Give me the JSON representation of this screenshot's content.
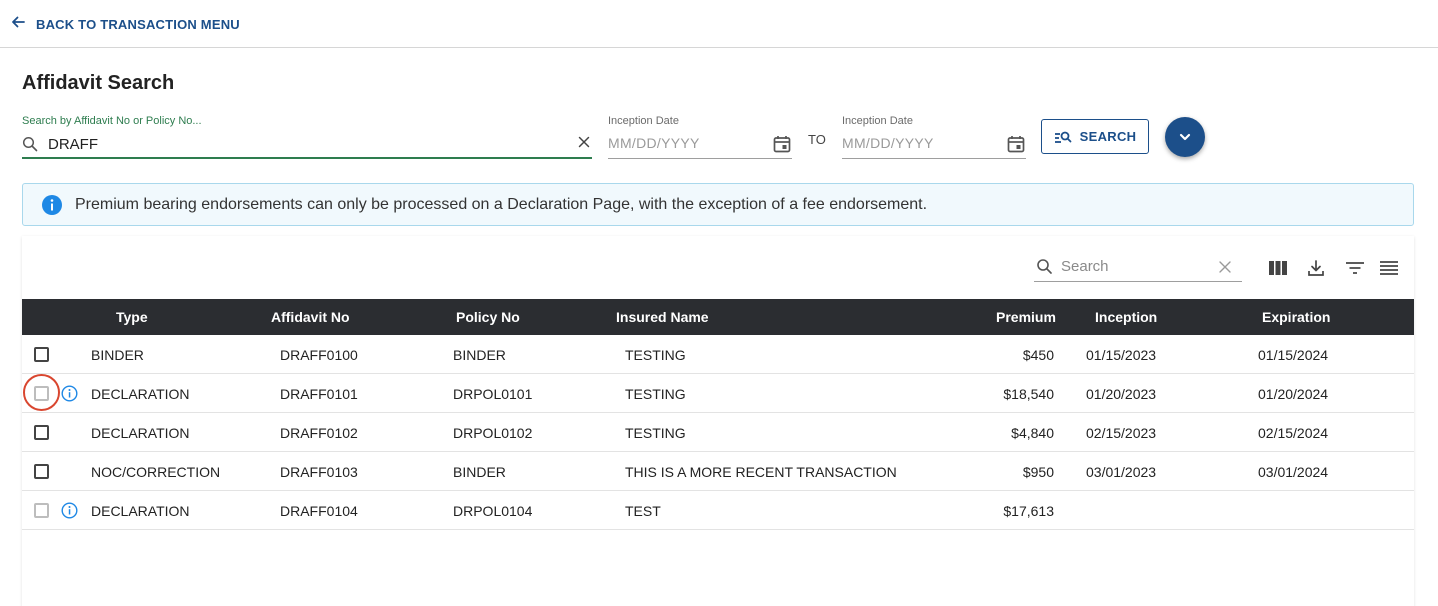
{
  "nav": {
    "back_label": "BACK TO TRANSACTION MENU"
  },
  "page": {
    "title": "Affidavit Search"
  },
  "filters": {
    "search_label": "Search by Affidavit No or Policy No...",
    "search_value": "DRAFF",
    "inception_from_label": "Inception Date",
    "inception_from_placeholder": "MM/DD/YYYY",
    "to_label": "TO",
    "inception_to_label": "Inception Date",
    "inception_to_placeholder": "MM/DD/YYYY",
    "search_button": "SEARCH"
  },
  "banner": {
    "message": "Premium bearing endorsements can only be processed on a Declaration Page, with the exception of a fee endorsement."
  },
  "table": {
    "search_placeholder": "Search",
    "columns": [
      "Type",
      "Affidavit No",
      "Policy No",
      "Insured Name",
      "Premium",
      "Inception",
      "Expiration"
    ],
    "rows": [
      {
        "type": "BINDER",
        "affidavit_no": "DRAFF0100",
        "policy_no": "BINDER",
        "insured_name": "TESTING",
        "premium": "$450",
        "inception": "01/15/2023",
        "expiration": "01/15/2024",
        "selectable": true,
        "info": false
      },
      {
        "type": "DECLARATION",
        "affidavit_no": "DRAFF0101",
        "policy_no": "DRPOL0101",
        "insured_name": "TESTING",
        "premium": "$18,540",
        "inception": "01/20/2023",
        "expiration": "01/20/2024",
        "selectable": false,
        "info": true
      },
      {
        "type": "DECLARATION",
        "affidavit_no": "DRAFF0102",
        "policy_no": "DRPOL0102",
        "insured_name": "TESTING",
        "premium": "$4,840",
        "inception": "02/15/2023",
        "expiration": "02/15/2024",
        "selectable": true,
        "info": false
      },
      {
        "type": "NOC/CORRECTION",
        "affidavit_no": "DRAFF0103",
        "policy_no": "BINDER",
        "insured_name": "THIS IS A MORE RECENT TRANSACTION",
        "premium": "$950",
        "inception": "03/01/2023",
        "expiration": "03/01/2024",
        "selectable": true,
        "info": false
      },
      {
        "type": "DECLARATION",
        "affidavit_no": "DRAFF0104",
        "policy_no": "DRPOL0104",
        "insured_name": "TEST",
        "premium": "$17,613",
        "inception": "",
        "expiration": "",
        "selectable": false,
        "info": true
      }
    ]
  },
  "colors": {
    "primary": "#1c4f8a",
    "header_bg": "#2b2d31",
    "focus_green": "#2e7d4f",
    "info_blue": "#1e88e5",
    "highlight_red": "#d9462f"
  }
}
